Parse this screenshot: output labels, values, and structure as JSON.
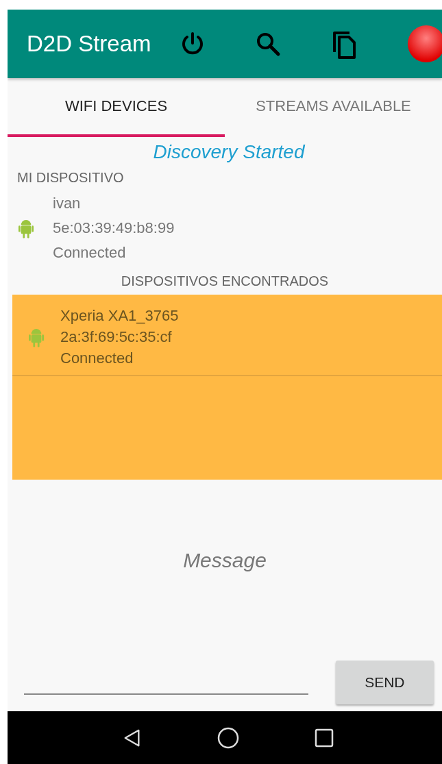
{
  "app_bar": {
    "title": "D2D Stream",
    "recording": true
  },
  "tabs": [
    {
      "label": "WIFI DEVICES",
      "selected": true
    },
    {
      "label": "STREAMS AVAILABLE",
      "selected": false
    }
  ],
  "status": "Discovery Started",
  "my_device": {
    "heading": "MI DISPOSITIVO",
    "name": "ivan",
    "address": "5e:03:39:49:b8:99",
    "state": "Connected"
  },
  "found_heading": "DISPOSITIVOS ENCONTRADOS",
  "found_devices": [
    {
      "name": "Xperia XA1_3765",
      "address": "2a:3f:69:5c:35:cf",
      "state": "Connected"
    }
  ],
  "message": "Message",
  "send_button": "SEND"
}
